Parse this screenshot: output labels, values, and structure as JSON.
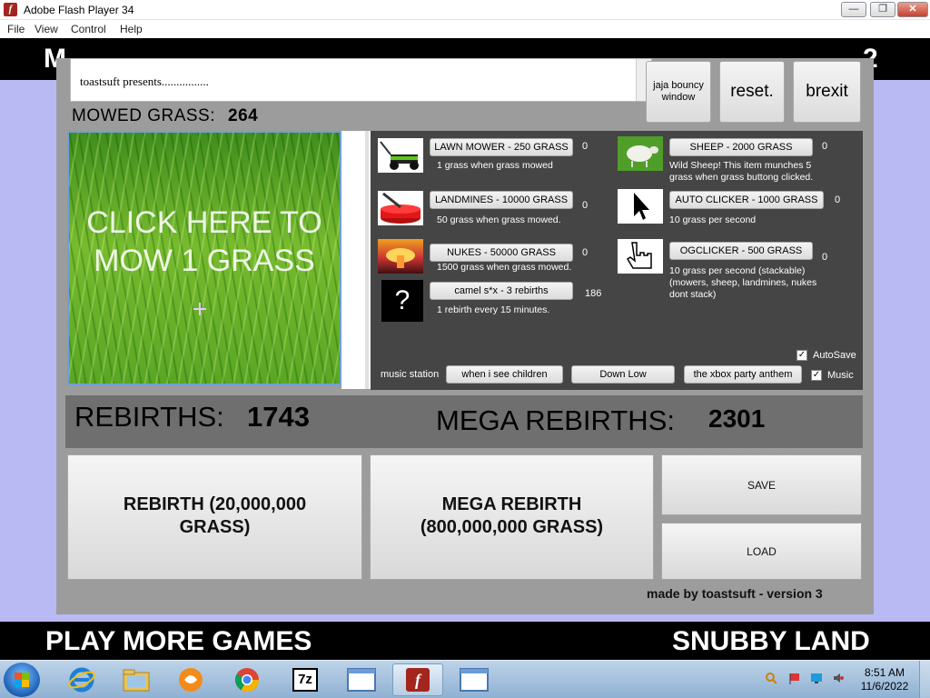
{
  "window": {
    "title": "Adobe Flash Player 34",
    "app_icon_glyph": "f",
    "minimize": "—",
    "maximize": "❐",
    "close": "✕"
  },
  "menu": [
    "File",
    "View",
    "Control",
    "Help"
  ],
  "top_band": {
    "left": "M",
    "right": "2"
  },
  "textbox": {
    "text": "toastsuft presents................"
  },
  "buttons": {
    "bouncy": "jaja bouncy window",
    "reset": "reset.",
    "brexit": "brexit"
  },
  "mowed": {
    "label": "MOWED GRASS:",
    "value": "264"
  },
  "grass": {
    "text": "CLICK HERE TO MOW 1 GRASS"
  },
  "shop": {
    "lawnmower": {
      "label": "LAWN MOWER - 250 GRASS",
      "count": "0",
      "desc": "1 grass when grass mowed"
    },
    "landmines": {
      "label": "LANDMINES - 10000 GRASS",
      "count": "0",
      "desc": "50 grass when grass mowed."
    },
    "nukes": {
      "label": "NUKES - 50000 GRASS",
      "count": "0",
      "desc": "1500 grass when grass mowed."
    },
    "camel": {
      "label": "camel s*x - 3 rebirths",
      "count": "186",
      "desc": "1 rebirth every 15 minutes.",
      "glyph": "?"
    },
    "sheep": {
      "label": "SHEEP - 2000 GRASS",
      "count": "0",
      "desc": "Wild Sheep! This item munches 5 grass when grass buttong clicked."
    },
    "autoclicker": {
      "label": "AUTO CLICKER - 1000 GRASS",
      "count": "0",
      "desc": "10 grass per second"
    },
    "ogclicker": {
      "label": "OGCLICKER - 500 GRASS",
      "count": "0",
      "desc": "10 grass per second (stackable) (mowers, sheep, landmines, nukes dont stack)"
    }
  },
  "music": {
    "label": "music station",
    "tracks": [
      "when i see children",
      "Down Low",
      "the xbox party anthem"
    ],
    "music_checkbox": "Music",
    "autosave_checkbox": "AutoSave"
  },
  "rebirths": {
    "label": "REBIRTHS:",
    "value": "1743",
    "mega_label": "MEGA REBIRTHS:",
    "mega_value": "2301"
  },
  "actions": {
    "rebirth": "REBIRTH (20,000,000 GRASS)",
    "mega": "MEGA REBIRTH (800,000,000 GRASS)",
    "save": "SAVE",
    "load": "LOAD"
  },
  "credit": "made by toastsuft - version 3",
  "bottom_band": {
    "left": "PLAY MORE GAMES",
    "right": "SNUBBY LAND"
  },
  "taskbar": {
    "time": "8:51 AM",
    "date": "11/6/2022",
    "zip_label": "7z"
  },
  "colors": {
    "panel": "#9c9c9c",
    "shop_bg": "#454545",
    "stage_bg": "#b9b9f3"
  }
}
